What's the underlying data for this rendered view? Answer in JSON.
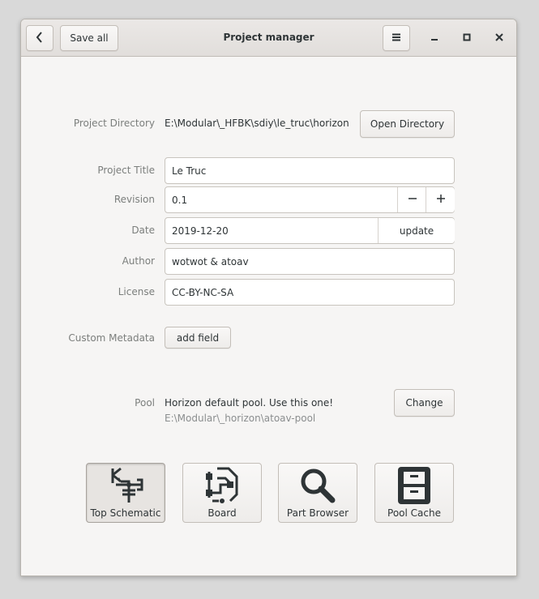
{
  "window": {
    "title": "Project manager"
  },
  "header": {
    "save_all_label": "Save all"
  },
  "fields": {
    "project_directory_label": "Project Directory",
    "project_directory_value": "E:\\Modular\\_HFBK\\sdiy\\le_truc\\horizon",
    "open_directory_label": "Open Directory",
    "project_title_label": "Project Title",
    "project_title_value": "Le Truc",
    "revision_label": "Revision",
    "revision_value": "0.1",
    "date_label": "Date",
    "date_value": "2019-12-20",
    "date_update_label": "update",
    "author_label": "Author",
    "author_value": "wotwot & atoav",
    "license_label": "License",
    "license_value": "CC-BY-NC-SA",
    "custom_metadata_label": "Custom Metadata",
    "add_field_label": "add field",
    "pool_label": "Pool",
    "pool_name": "Horizon default pool. Use this one!",
    "pool_path": "E:\\Modular\\_horizon\\atoav-pool",
    "change_label": "Change"
  },
  "launchers": [
    {
      "label": "Top Schematic",
      "icon": "schematic-icon",
      "active": true
    },
    {
      "label": "Board",
      "icon": "board-icon",
      "active": false
    },
    {
      "label": "Part Browser",
      "icon": "magnifier-icon",
      "active": false
    },
    {
      "label": "Pool Cache",
      "icon": "file-cabinet-icon",
      "active": false
    }
  ],
  "colors": {
    "window_bg": "#f6f5f4",
    "headerbar": "#e1dedb",
    "label_gray": "#7b7e7c"
  }
}
